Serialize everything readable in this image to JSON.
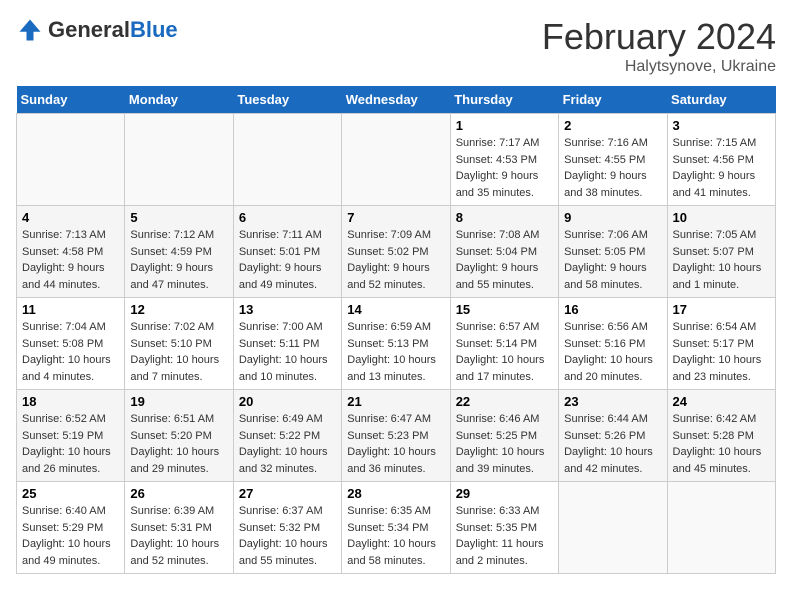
{
  "header": {
    "logo_general": "General",
    "logo_blue": "Blue",
    "month": "February 2024",
    "location": "Halytsynove, Ukraine"
  },
  "days_of_week": [
    "Sunday",
    "Monday",
    "Tuesday",
    "Wednesday",
    "Thursday",
    "Friday",
    "Saturday"
  ],
  "weeks": [
    [
      {
        "day": "",
        "info": ""
      },
      {
        "day": "",
        "info": ""
      },
      {
        "day": "",
        "info": ""
      },
      {
        "day": "",
        "info": ""
      },
      {
        "day": "1",
        "info": "Sunrise: 7:17 AM\nSunset: 4:53 PM\nDaylight: 9 hours\nand 35 minutes."
      },
      {
        "day": "2",
        "info": "Sunrise: 7:16 AM\nSunset: 4:55 PM\nDaylight: 9 hours\nand 38 minutes."
      },
      {
        "day": "3",
        "info": "Sunrise: 7:15 AM\nSunset: 4:56 PM\nDaylight: 9 hours\nand 41 minutes."
      }
    ],
    [
      {
        "day": "4",
        "info": "Sunrise: 7:13 AM\nSunset: 4:58 PM\nDaylight: 9 hours\nand 44 minutes."
      },
      {
        "day": "5",
        "info": "Sunrise: 7:12 AM\nSunset: 4:59 PM\nDaylight: 9 hours\nand 47 minutes."
      },
      {
        "day": "6",
        "info": "Sunrise: 7:11 AM\nSunset: 5:01 PM\nDaylight: 9 hours\nand 49 minutes."
      },
      {
        "day": "7",
        "info": "Sunrise: 7:09 AM\nSunset: 5:02 PM\nDaylight: 9 hours\nand 52 minutes."
      },
      {
        "day": "8",
        "info": "Sunrise: 7:08 AM\nSunset: 5:04 PM\nDaylight: 9 hours\nand 55 minutes."
      },
      {
        "day": "9",
        "info": "Sunrise: 7:06 AM\nSunset: 5:05 PM\nDaylight: 9 hours\nand 58 minutes."
      },
      {
        "day": "10",
        "info": "Sunrise: 7:05 AM\nSunset: 5:07 PM\nDaylight: 10 hours\nand 1 minute."
      }
    ],
    [
      {
        "day": "11",
        "info": "Sunrise: 7:04 AM\nSunset: 5:08 PM\nDaylight: 10 hours\nand 4 minutes."
      },
      {
        "day": "12",
        "info": "Sunrise: 7:02 AM\nSunset: 5:10 PM\nDaylight: 10 hours\nand 7 minutes."
      },
      {
        "day": "13",
        "info": "Sunrise: 7:00 AM\nSunset: 5:11 PM\nDaylight: 10 hours\nand 10 minutes."
      },
      {
        "day": "14",
        "info": "Sunrise: 6:59 AM\nSunset: 5:13 PM\nDaylight: 10 hours\nand 13 minutes."
      },
      {
        "day": "15",
        "info": "Sunrise: 6:57 AM\nSunset: 5:14 PM\nDaylight: 10 hours\nand 17 minutes."
      },
      {
        "day": "16",
        "info": "Sunrise: 6:56 AM\nSunset: 5:16 PM\nDaylight: 10 hours\nand 20 minutes."
      },
      {
        "day": "17",
        "info": "Sunrise: 6:54 AM\nSunset: 5:17 PM\nDaylight: 10 hours\nand 23 minutes."
      }
    ],
    [
      {
        "day": "18",
        "info": "Sunrise: 6:52 AM\nSunset: 5:19 PM\nDaylight: 10 hours\nand 26 minutes."
      },
      {
        "day": "19",
        "info": "Sunrise: 6:51 AM\nSunset: 5:20 PM\nDaylight: 10 hours\nand 29 minutes."
      },
      {
        "day": "20",
        "info": "Sunrise: 6:49 AM\nSunset: 5:22 PM\nDaylight: 10 hours\nand 32 minutes."
      },
      {
        "day": "21",
        "info": "Sunrise: 6:47 AM\nSunset: 5:23 PM\nDaylight: 10 hours\nand 36 minutes."
      },
      {
        "day": "22",
        "info": "Sunrise: 6:46 AM\nSunset: 5:25 PM\nDaylight: 10 hours\nand 39 minutes."
      },
      {
        "day": "23",
        "info": "Sunrise: 6:44 AM\nSunset: 5:26 PM\nDaylight: 10 hours\nand 42 minutes."
      },
      {
        "day": "24",
        "info": "Sunrise: 6:42 AM\nSunset: 5:28 PM\nDaylight: 10 hours\nand 45 minutes."
      }
    ],
    [
      {
        "day": "25",
        "info": "Sunrise: 6:40 AM\nSunset: 5:29 PM\nDaylight: 10 hours\nand 49 minutes."
      },
      {
        "day": "26",
        "info": "Sunrise: 6:39 AM\nSunset: 5:31 PM\nDaylight: 10 hours\nand 52 minutes."
      },
      {
        "day": "27",
        "info": "Sunrise: 6:37 AM\nSunset: 5:32 PM\nDaylight: 10 hours\nand 55 minutes."
      },
      {
        "day": "28",
        "info": "Sunrise: 6:35 AM\nSunset: 5:34 PM\nDaylight: 10 hours\nand 58 minutes."
      },
      {
        "day": "29",
        "info": "Sunrise: 6:33 AM\nSunset: 5:35 PM\nDaylight: 11 hours\nand 2 minutes."
      },
      {
        "day": "",
        "info": ""
      },
      {
        "day": "",
        "info": ""
      }
    ]
  ]
}
